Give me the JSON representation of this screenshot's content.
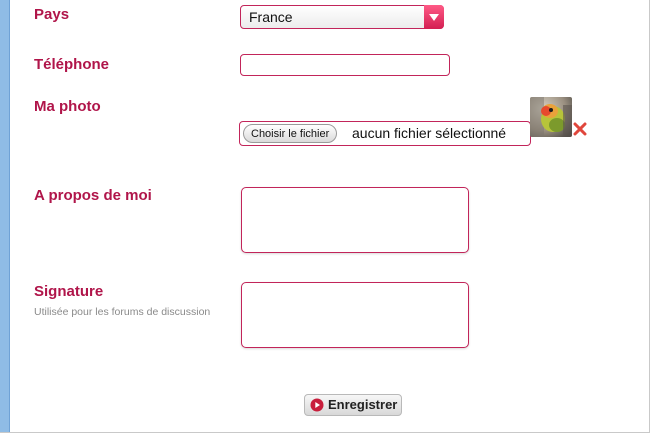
{
  "colors": {
    "accent": "#b0154a",
    "border": "#c2255a",
    "sidebar": "#8fbce6"
  },
  "fields": {
    "pays": {
      "label": "Pays",
      "selected": "France"
    },
    "telephone": {
      "label": "Téléphone",
      "value": ""
    },
    "photo": {
      "label": "Ma photo",
      "button_label": "Choisir le fichier",
      "status": "aucun fichier sélectionné",
      "thumbnail_icon": "bird-photo-thumbnail",
      "remove_icon": "close-icon"
    },
    "about": {
      "label": "A propos de moi",
      "value": ""
    },
    "signature": {
      "label": "Signature",
      "hint": "Utilisée pour les forums de discussion",
      "value": ""
    }
  },
  "actions": {
    "submit_label": "Enregistrer",
    "submit_icon": "play-circle-icon"
  }
}
